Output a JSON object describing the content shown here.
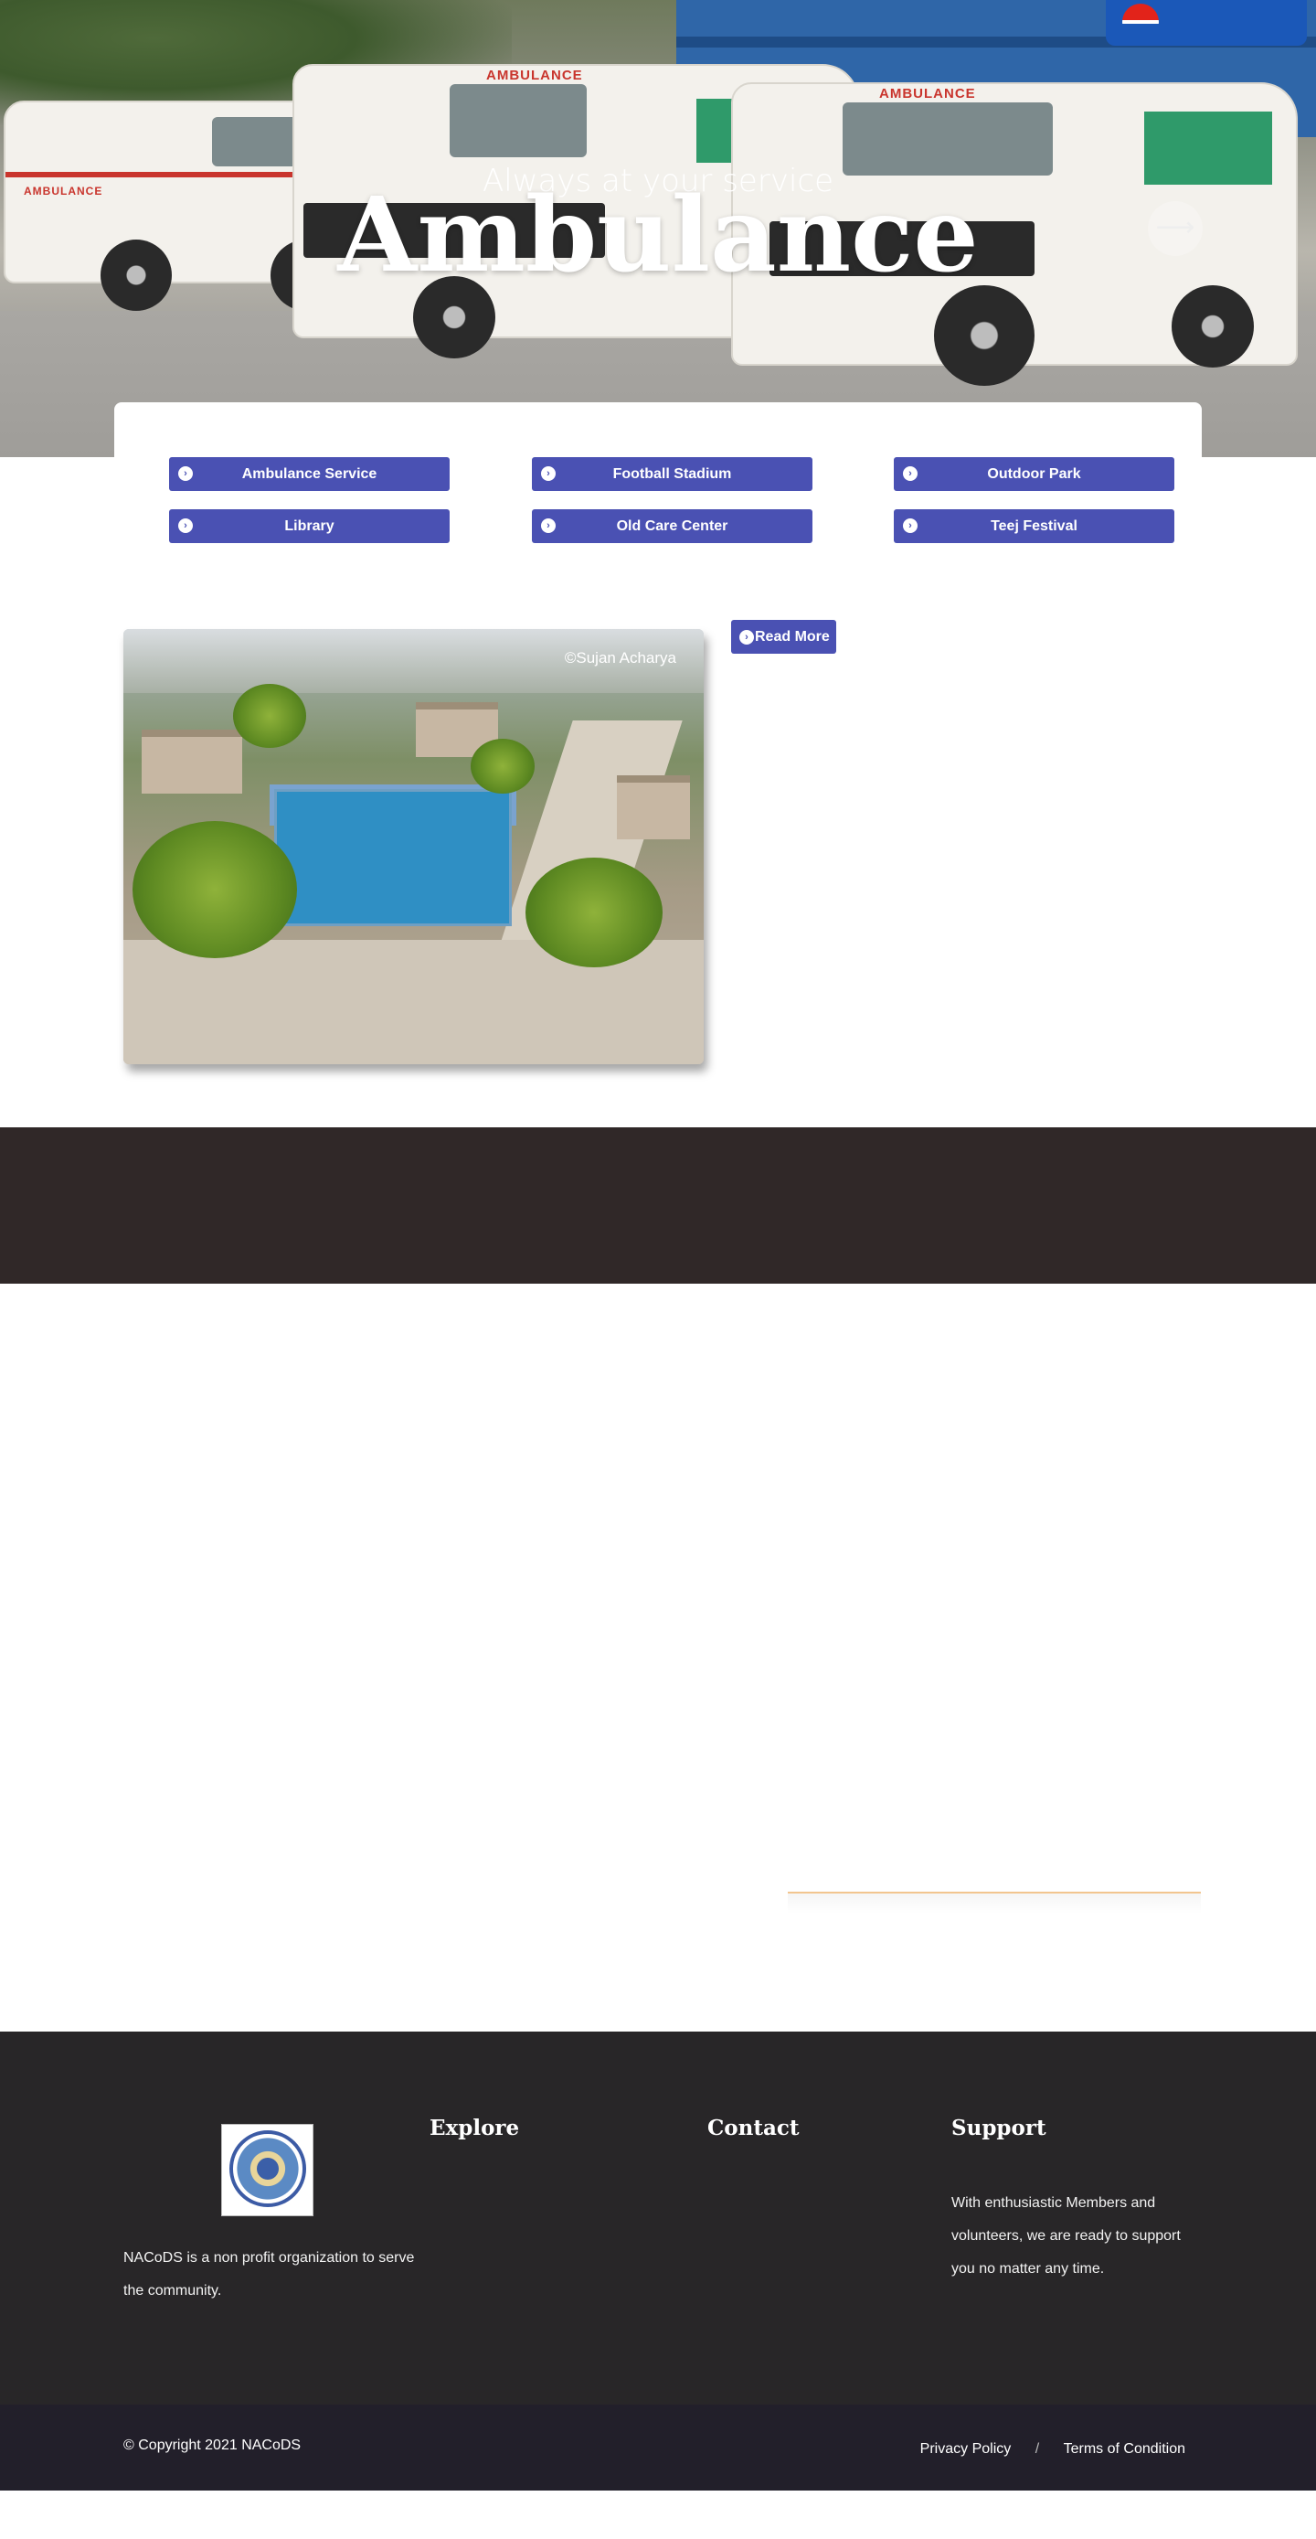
{
  "hero": {
    "subtitle": "Always at your service",
    "title": "Ambulance",
    "next_icon": "arrow-right-icon",
    "van_labels": [
      "AMBULANCE",
      "AMBULANCE",
      "AMBULANCE"
    ]
  },
  "services": {
    "items": [
      {
        "label": "Ambulance Service",
        "icon": "chevron-circle-right-icon"
      },
      {
        "label": "Football Stadium",
        "icon": "chevron-circle-right-icon"
      },
      {
        "label": "Outdoor Park",
        "icon": "chevron-circle-right-icon"
      },
      {
        "label": "Library",
        "icon": "chevron-circle-right-icon"
      },
      {
        "label": "Old Care Center",
        "icon": "chevron-circle-right-icon"
      },
      {
        "label": "Teej Festival",
        "icon": "chevron-circle-right-icon"
      }
    ],
    "accent_color": "#4a51b3"
  },
  "feature": {
    "photo_credit": "©Sujan Acharya",
    "read_more_label": "Read More"
  },
  "band": {
    "color": "#302828"
  },
  "footer": {
    "about_text": "NACoDS is a non profit organization to serve the community.",
    "explore_heading": "Explore",
    "contact_heading": "Contact",
    "support_heading": "Support",
    "support_text": "With enthusiastic Members  and volunteers, we are ready to support you no matter any time.",
    "copyright": "© Copyright 2021 NACoDS",
    "privacy_label": "Privacy Policy",
    "link_separator": "/",
    "terms_label": "Terms of Condition"
  }
}
